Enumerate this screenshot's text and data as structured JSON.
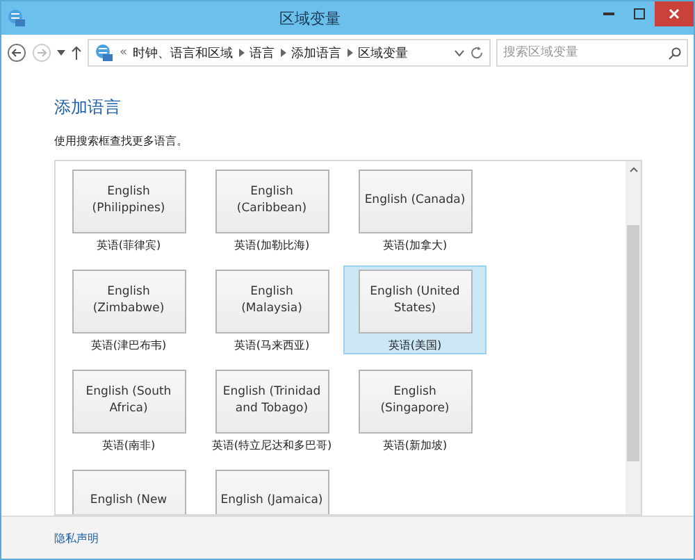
{
  "window": {
    "title": "区域变量"
  },
  "address_bar": {
    "overflow": "«",
    "crumbs": [
      "时钟、语言和区域",
      "语言",
      "添加语言",
      "区域变量"
    ]
  },
  "search": {
    "placeholder": "搜索区域变量"
  },
  "heading": "添加语言",
  "description": "使用搜索框查找更多语言。",
  "languages": [
    {
      "name": "English (Philippines)",
      "native": "英语(菲律宾)",
      "selected": false
    },
    {
      "name": "English (Caribbean)",
      "native": "英语(加勒比海)",
      "selected": false
    },
    {
      "name": "English (Canada)",
      "native": "英语(加拿大)",
      "selected": false
    },
    {
      "name": "English (Zimbabwe)",
      "native": "英语(津巴布韦)",
      "selected": false
    },
    {
      "name": "English (Malaysia)",
      "native": "英语(马来西亚)",
      "selected": false
    },
    {
      "name": "English (United States)",
      "native": "英语(美国)",
      "selected": true
    },
    {
      "name": "English (South Africa)",
      "native": "英语(南非)",
      "selected": false
    },
    {
      "name": "English (Trinidad and Tobago)",
      "native": "英语(特立尼达和多巴哥)",
      "selected": false
    },
    {
      "name": "English (Singapore)",
      "native": "英语(新加坡)",
      "selected": false
    },
    {
      "name": "English (New",
      "selected": false
    },
    {
      "name": "English (Jamaica)",
      "selected": false
    }
  ],
  "footer": {
    "link": "隐私声明"
  }
}
